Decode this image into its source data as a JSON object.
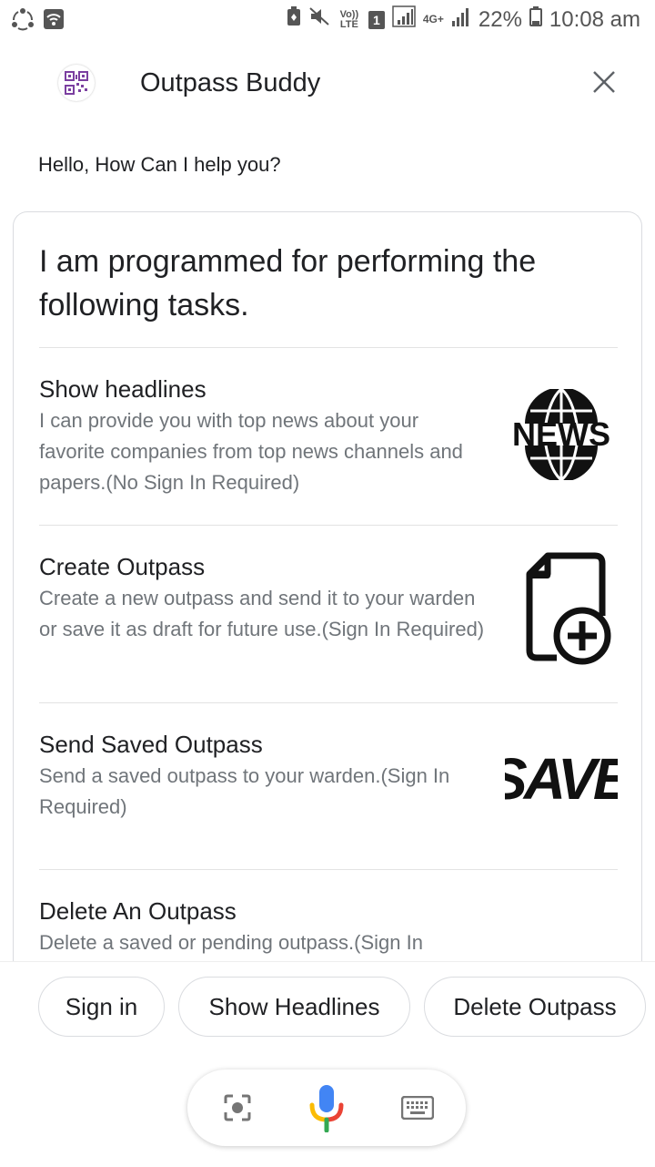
{
  "status_bar": {
    "volte": "Vo)) LTE",
    "sim_number": "1",
    "network": "4G+",
    "battery": "22%",
    "time": "10:08 am"
  },
  "header": {
    "title": "Outpass Buddy",
    "logo_icon": "qr-code-icon",
    "close_icon": "close-icon"
  },
  "greeting": "Hello, How Can I help you?",
  "card": {
    "heading": "I am programmed for performing the following tasks.",
    "items": [
      {
        "title": "Show headlines",
        "description": "I can provide you with top news about your favorite companies from top news channels and papers.(No Sign In Required)",
        "image_text": "NEWS",
        "image_icon": "news-globe-icon"
      },
      {
        "title": "Create Outpass",
        "description": "Create a new outpass and send it to your warden or save it as draft for future use.(Sign In Required)",
        "image_icon": "new-document-icon"
      },
      {
        "title": "Send Saved Outpass",
        "description": "Send a saved outpass to your warden.(Sign In Required)",
        "image_text": "SAVE",
        "image_icon": "save-text-icon"
      },
      {
        "title": "Delete An Outpass",
        "description": "Delete a saved or pending outpass.(Sign In Required)"
      }
    ]
  },
  "chips": [
    "Sign in",
    "Show Headlines",
    "Delete Outpass"
  ],
  "bottom_bar": {
    "lens_icon": "lens-icon",
    "mic_icon": "mic-icon",
    "keyboard_icon": "keyboard-icon"
  },
  "colors": {
    "accent_blue": "#4285f4",
    "accent_red": "#ea4335",
    "accent_yellow": "#fbbc05",
    "accent_green": "#34a853",
    "secondary_text": "#70757a"
  }
}
